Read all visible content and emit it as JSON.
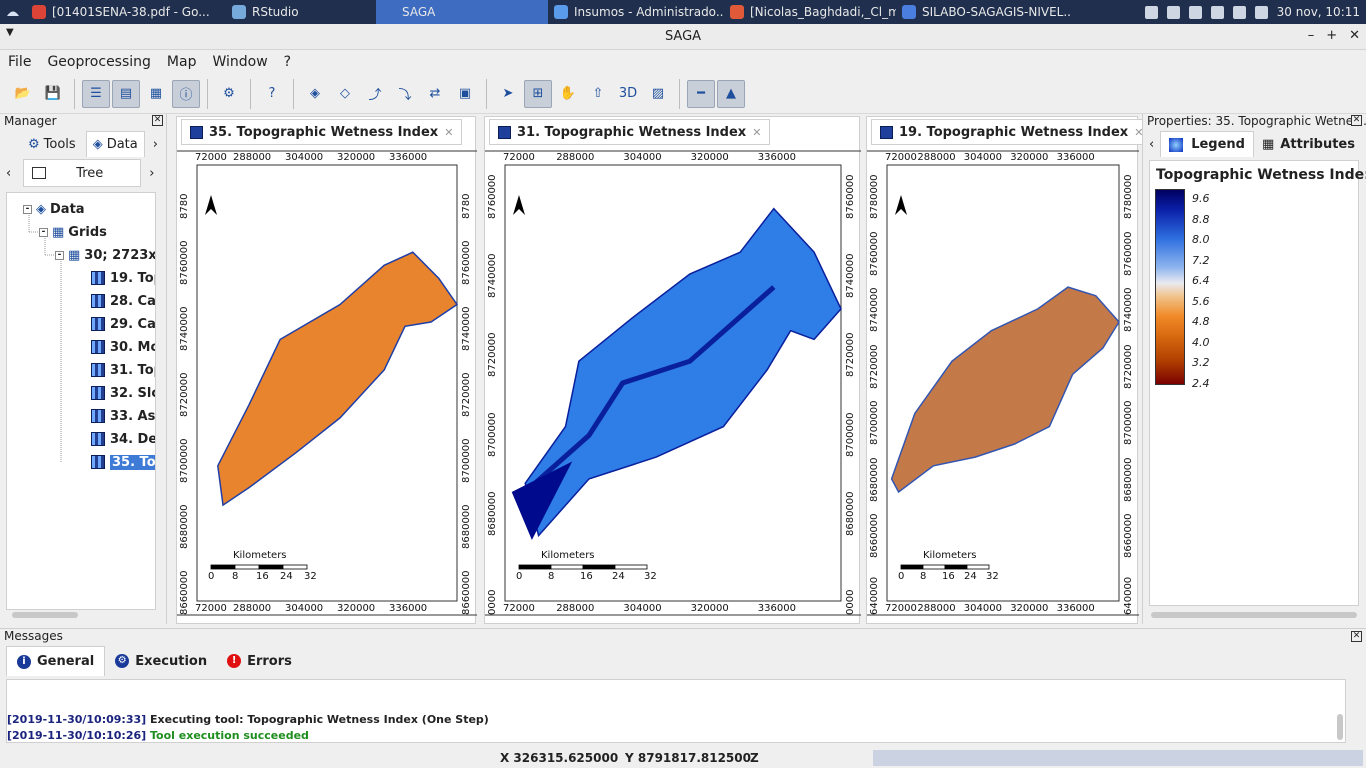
{
  "taskbar": {
    "tasks": [
      {
        "label": "[01401SENA-38.pdf - Go...",
        "color": "#db4437"
      },
      {
        "label": "RStudio",
        "color": "#75aadb"
      },
      {
        "label": "SAGA",
        "color": "#3d6cc0"
      },
      {
        "label": "Insumos - Administrado...",
        "color": "#5a9bea"
      },
      {
        "label": "[Nicolas_Baghdadi,_Cl_m...",
        "color": "#e05a3a"
      },
      {
        "label": "SILABO-SAGAGIS-NIVEL...",
        "color": "#4a7fe0"
      }
    ],
    "clock": "30 nov, 10:11",
    "active_task_index": 2
  },
  "window": {
    "title": "SAGA",
    "minimize": "–",
    "maximize": "+",
    "close": "✕",
    "menu": "▼"
  },
  "menu": [
    "File",
    "Geoprocessing",
    "Map",
    "Window",
    "?"
  ],
  "toolbar_icons": [
    "open-icon",
    "save-icon",
    "data-view-icon",
    "workspace-icon",
    "grid-view-icon",
    "info-icon",
    "tools-icon",
    "help-icon",
    "zoom-full-icon",
    "zoom-active-icon",
    "zoom-previous-icon",
    "zoom-next-icon",
    "synchronize-icon",
    "layer-icon",
    "arrow-icon",
    "zoom-icon",
    "pan-icon",
    "pan-up-icon",
    "3d-view-icon",
    "histogram-icon",
    "scale-bar-icon",
    "north-arrow-icon"
  ],
  "manager": {
    "title": "Manager",
    "tabs": {
      "tools": "Tools",
      "data": "Data"
    },
    "subtab": "Tree",
    "tree": {
      "root": "Data",
      "grids": "Grids",
      "system": "30; 2723x",
      "items": [
        "19. Topo",
        "28. Cato",
        "29. Cato",
        "30. Mod",
        "31. Topo",
        "32. Slop",
        "33. Asp",
        "34. Dem",
        "35. Topo"
      ],
      "selected_index": 8
    }
  },
  "maps": [
    {
      "tab": "35. Topographic Wetness Index",
      "x_ticks": [
        "72000",
        "288000",
        "304000",
        "320000",
        "336000"
      ],
      "y_ticks_left": [
        "8780",
        "8760000",
        "8740000",
        "8720000",
        "8700000",
        "8680000",
        "8660000"
      ],
      "y_ticks_right": [
        "8780",
        "8760000",
        "8740000",
        "8720000",
        "8700000",
        "8680000",
        "8660000"
      ],
      "scale": {
        "title": "Kilometers",
        "labels": [
          "0",
          "8",
          "16",
          "24",
          "32"
        ]
      },
      "style": "orange"
    },
    {
      "tab": "31. Topographic Wetness Index",
      "x_ticks": [
        "72000",
        "288000",
        "304000",
        "320000",
        "336000"
      ],
      "y_ticks_left": [
        "8760000",
        "8740000",
        "8720000",
        "8700000",
        "8680000",
        "0000"
      ],
      "y_ticks_right": [
        "8760000",
        "8740000",
        "8720000",
        "8700000",
        "8680000",
        "0000"
      ],
      "scale": {
        "title": "Kilometers",
        "labels": [
          "0",
          "8",
          "16",
          "24",
          "32"
        ]
      },
      "style": "blue"
    },
    {
      "tab": "19. Topographic Wetness Index",
      "x_ticks": [
        "72000",
        "288000",
        "304000",
        "320000",
        "336000"
      ],
      "y_ticks_left": [
        "8780000",
        "8760000",
        "8740000",
        "8720000",
        "8700000",
        "8680000",
        "8660000",
        "640000"
      ],
      "y_ticks_right": [
        "8780000",
        "8760000",
        "8740000",
        "8720000",
        "8700000",
        "8680000",
        "8660000",
        "640000"
      ],
      "scale": {
        "title": "Kilometers",
        "labels": [
          "0",
          "8",
          "16",
          "24",
          "32"
        ]
      },
      "style": "mixed"
    }
  ],
  "properties": {
    "title": "Properties: 35. Topographic Wetnes...",
    "tabs": {
      "legend": "Legend",
      "attributes": "Attributes"
    },
    "legend_title": "Topographic Wetness Inde:",
    "legend_values": [
      "9.6",
      "8.8",
      "8.0",
      "7.2",
      "6.4",
      "5.6",
      "4.8",
      "4.0",
      "3.2",
      "2.4"
    ]
  },
  "messages": {
    "title": "Messages",
    "tabs": {
      "general": "General",
      "execution": "Execution",
      "errors": "Errors"
    },
    "log": [
      {
        "ts": "[2019-11-30/10:09:33]",
        "text": "Executing tool: Topographic Wetness Index (One Step)",
        "kind": "normal"
      },
      {
        "ts": "[2019-11-30/10:10:26]",
        "text": "Tool execution succeeded",
        "kind": "success"
      }
    ]
  },
  "status": {
    "x": "X 326315.625000",
    "y": "Y 8791817.812500",
    "z": "Z"
  }
}
